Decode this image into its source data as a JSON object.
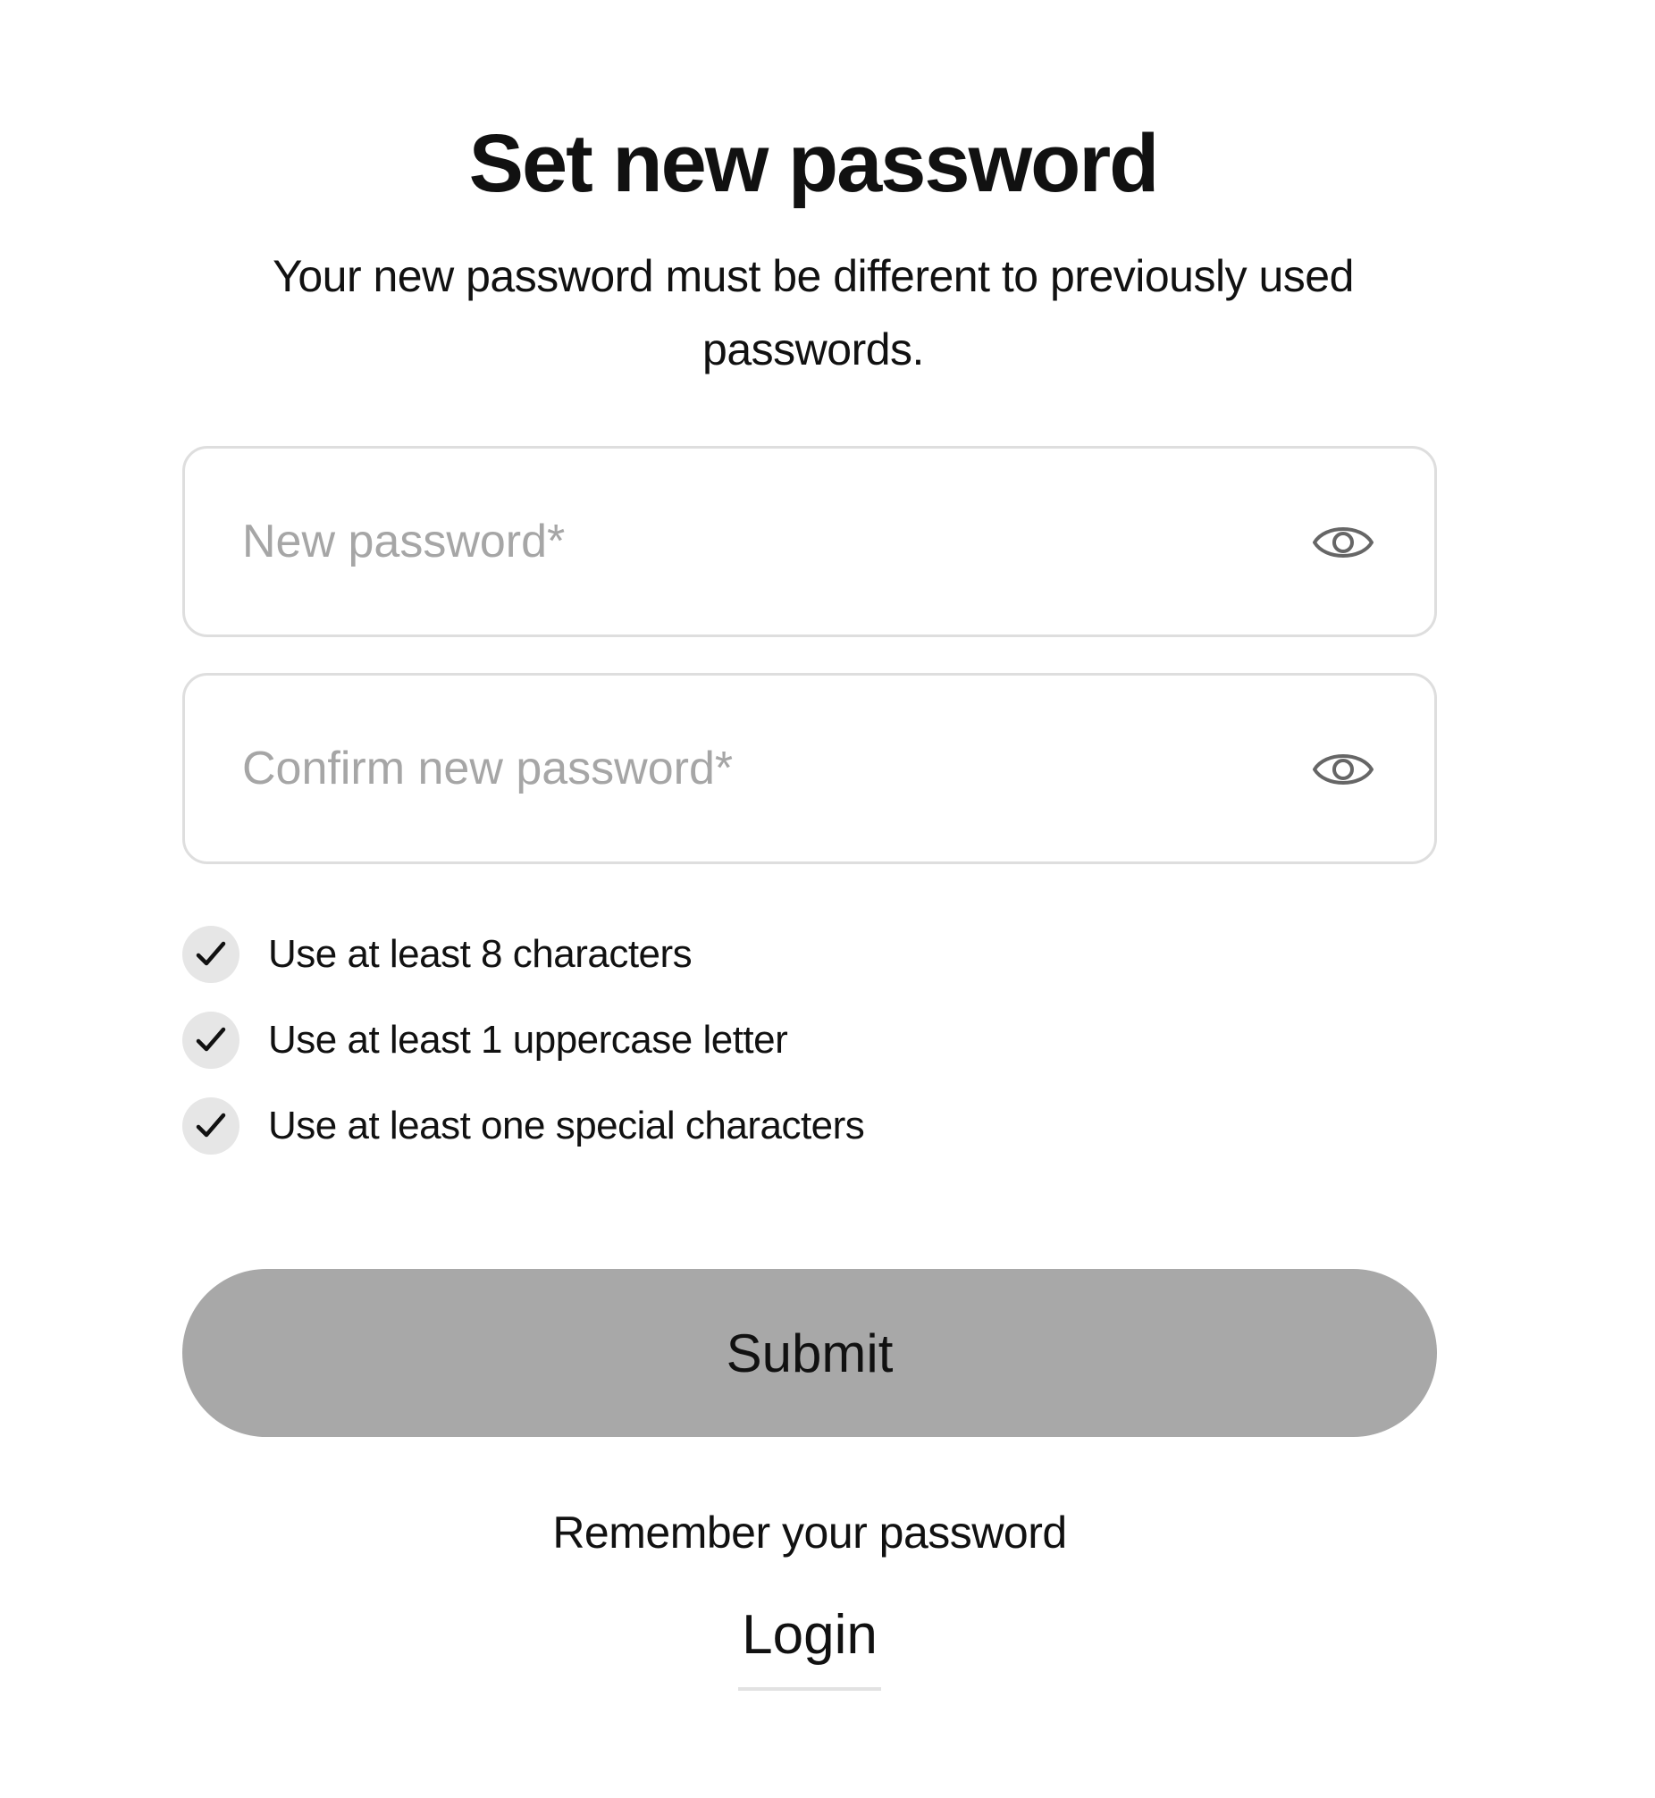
{
  "header": {
    "title": "Set new password",
    "subtitle": "Your new password must be different to previously used passwords."
  },
  "form": {
    "new_password": {
      "value": "",
      "placeholder": "New password*",
      "toggle_icon": "eye-icon"
    },
    "confirm_password": {
      "value": "",
      "placeholder": "Confirm new password*",
      "toggle_icon": "eye-icon"
    }
  },
  "requirements": [
    {
      "label": "Use at least 8 characters",
      "icon": "checkmark-icon"
    },
    {
      "label": "Use at least 1 uppercase letter",
      "icon": "checkmark-icon"
    },
    {
      "label": "Use at least one special characters",
      "icon": "checkmark-icon"
    }
  ],
  "actions": {
    "submit_label": "Submit",
    "submit_color": "#a8a8a8",
    "remember_text": "Remember your password",
    "login_label": "Login"
  }
}
